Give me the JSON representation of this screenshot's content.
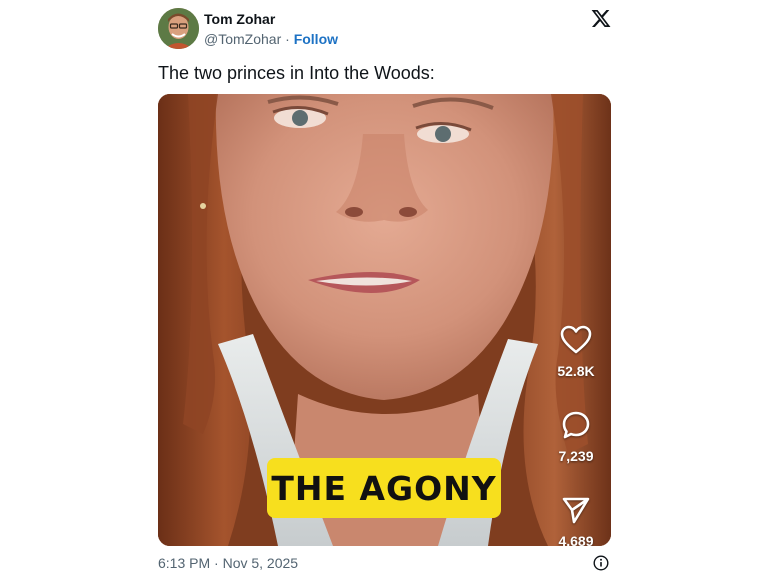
{
  "author": {
    "name": "Tom Zohar",
    "handle": "@TomZohar",
    "separator": "·",
    "follow_label": "Follow"
  },
  "platform_icon": "x-logo-icon",
  "tweet": {
    "text": "The two princes in Into the Woods:"
  },
  "video": {
    "caption": "THE AGONY",
    "actions": [
      {
        "icon": "heart-icon",
        "count": "52.8K"
      },
      {
        "icon": "comment-bubble-icon",
        "count": "7,239"
      },
      {
        "icon": "share-send-icon",
        "count": "4,689"
      }
    ]
  },
  "footer": {
    "timestamp": "6:13 PM · Nov 5, 2025",
    "info_icon": "info-icon"
  },
  "colors": {
    "follow_link": "#1d72c4",
    "secondary_text": "#536471",
    "caption_background": "#f7df1e"
  }
}
